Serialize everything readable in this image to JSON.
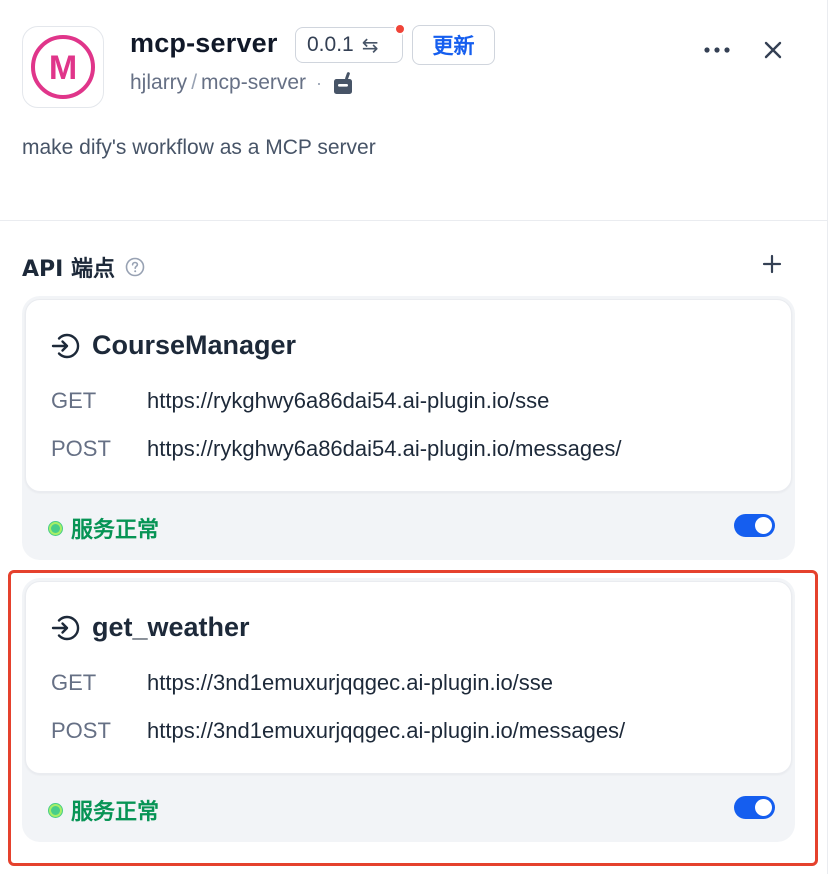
{
  "plugin": {
    "logo_letter": "M",
    "title": "mcp-server",
    "version": "0.0.1",
    "version_swap_icon": "⇆",
    "update_label": "更新",
    "org": "hjlarry",
    "separator": "/",
    "repo": "mcp-server",
    "dot": "·",
    "description": "make dify's workflow as a MCP server"
  },
  "section": {
    "title": "API 端点"
  },
  "endpoints": [
    {
      "name": "CourseManager",
      "get_label": "GET",
      "get_url": "https://rykghwy6a86dai54.ai-plugin.io/sse",
      "post_label": "POST",
      "post_url": "https://rykghwy6a86dai54.ai-plugin.io/messages/",
      "status": "服务正常",
      "enabled": true
    },
    {
      "name": "get_weather",
      "get_label": "GET",
      "get_url": "https://3nd1emuxurjqqgec.ai-plugin.io/sse",
      "post_label": "POST",
      "post_url": "https://3nd1emuxurjqqgec.ai-plugin.io/messages/",
      "status": "服务正常",
      "enabled": true
    }
  ],
  "colors": {
    "accent": "#155eef",
    "logo": "#e0358a",
    "status_ok": "#079455",
    "highlight": "#e5412d"
  }
}
